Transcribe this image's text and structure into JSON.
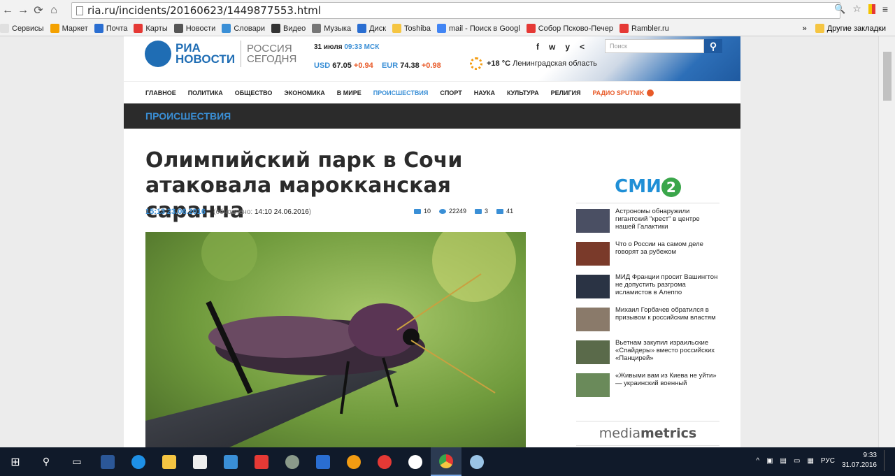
{
  "browser": {
    "url": "ria.ru/incidents/20160623/1449877553.html",
    "bookmarks": [
      {
        "label": "Сервисы",
        "color": "#e0e0e0"
      },
      {
        "label": "Маркет",
        "color": "#f4a100"
      },
      {
        "label": "Почта",
        "color": "#2a6ed1"
      },
      {
        "label": "Карты",
        "color": "#e53935"
      },
      {
        "label": "Новости",
        "color": "#555555"
      },
      {
        "label": "Словари",
        "color": "#3a8fd6"
      },
      {
        "label": "Видео",
        "color": "#333333"
      },
      {
        "label": "Музыка",
        "color": "#777777"
      },
      {
        "label": "Диск",
        "color": "#2a6ed1"
      },
      {
        "label": "Toshiba",
        "color": "#f5c542"
      },
      {
        "label": "mail - Поиск в Googl",
        "color": "#4285f4"
      },
      {
        "label": "Собор Псково-Печер",
        "color": "#e53935"
      },
      {
        "label": "Rambler.ru",
        "color": "#e53935"
      }
    ],
    "bookmarks_more": "»",
    "other_bookmarks": "Другие закладки"
  },
  "header": {
    "logo_main_1": "РИА",
    "logo_main_2": "НОВОСТИ",
    "logo_side_1": "РОССИЯ",
    "logo_side_2": "СЕГОДНЯ",
    "date": "31 июля",
    "time": "09:33 МСК",
    "usd_label": "USD",
    "usd_value": "67.05",
    "usd_delta": "+0.94",
    "eur_label": "EUR",
    "eur_value": "74.38",
    "eur_delta": "+0.98",
    "temperature": "+18 °C",
    "region": "Ленинградская область",
    "social": [
      "f",
      "w",
      "y",
      "<"
    ],
    "search_placeholder": "Поиск"
  },
  "menu": {
    "items": [
      "ГЛАВНОЕ",
      "ПОЛИТИКА",
      "ОБЩЕСТВО",
      "ЭКОНОМИКА",
      "В МИРЕ",
      "ПРОИСШЕСТВИЯ",
      "СПОРТ",
      "НАУКА",
      "КУЛЬТУРА",
      "РЕЛИГИЯ"
    ],
    "radio": "РАДИО SPUTNIK"
  },
  "section": "ПРОИСШЕСТВИЯ",
  "article": {
    "title": "Олимпийский парк в Сочи атаковала марокканская саранча",
    "time": "15:13",
    "date": "23.06.2016",
    "updated_prefix": "(обновлено:",
    "updated_value": "14:10 24.06.2016",
    "updated_suffix": ")",
    "comments": "10",
    "views": "22249",
    "likes": "3",
    "shares": "41"
  },
  "sidebar": {
    "smi_label": "СМИ",
    "smi_number": "2",
    "items": [
      {
        "text": "Астрономы обнаружили гигантский \"крест\" в центре нашей Галактики",
        "thumb": "#4a4f63"
      },
      {
        "text": "Что о России на самом деле говорят за рубежом",
        "thumb": "#7a3a2a"
      },
      {
        "text": "МИД Франции просит Вашингтон не допустить разгрома исламистов в Алеппо",
        "thumb": "#2a3344"
      },
      {
        "text": "Михаил Горбачев обратился в призывом к российским властям",
        "thumb": "#8a7a6a"
      },
      {
        "text": "Вьетнам закупил израильские «Спайдеры» вместо российских «Панцирей»",
        "thumb": "#5a6a4a"
      },
      {
        "text": "«Живыми вам из Киева не уйти» — украинский военный",
        "thumb": "#6a8a5a"
      }
    ],
    "mediametrics_1": "media",
    "mediametrics_2": "metrics"
  },
  "taskbar": {
    "lang": "РУС",
    "time": "9:33",
    "date": "31.07.2016"
  }
}
